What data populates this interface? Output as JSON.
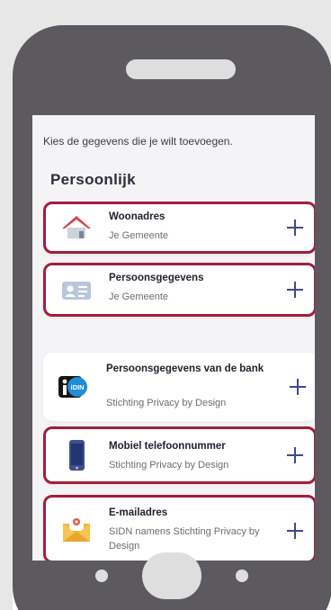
{
  "intro": "Kies de gegevens die je wilt toevoegen.",
  "section_title": "Persoonlijk",
  "highlight_color": "#a01f3c",
  "accent_color": "#3b4a8c",
  "items": [
    {
      "title": "Woonadres",
      "subtitle": "Je Gemeente",
      "icon": "house-icon",
      "highlighted": true
    },
    {
      "title": "Persoonsgegevens",
      "subtitle": "Je Gemeente",
      "icon": "id-card-icon",
      "highlighted": true
    },
    {
      "title": "Persoonsgegevens van de bank",
      "subtitle": "Stichting Privacy by Design",
      "icon": "idin-icon",
      "idin_text": "iDIN",
      "highlighted": false
    },
    {
      "title": "Mobiel telefoonnummer",
      "subtitle": "Stichting Privacy by Design",
      "icon": "mobile-phone-icon",
      "highlighted": true
    },
    {
      "title": "E-mailadres",
      "subtitle": "SIDN namens Stichting Privacy by Design",
      "icon": "envelope-icon",
      "highlighted": true
    }
  ]
}
